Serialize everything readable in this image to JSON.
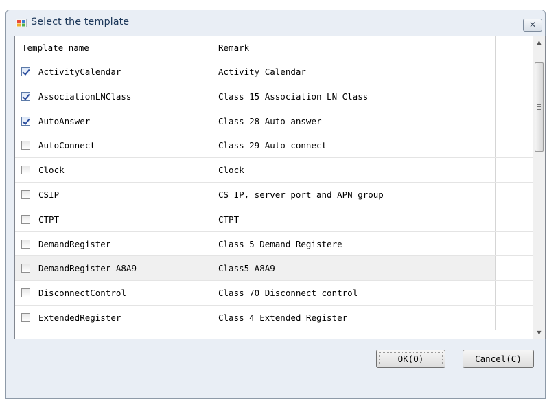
{
  "window": {
    "title": "Select the template",
    "close_glyph": "✕"
  },
  "grid": {
    "headers": [
      "Template name",
      "Remark"
    ],
    "rows": [
      {
        "name": "ActivityCalendar",
        "remark": "Activity Calendar",
        "checked": true
      },
      {
        "name": "AssociationLNClass",
        "remark": "Class 15 Association LN Class",
        "checked": true
      },
      {
        "name": "AutoAnswer",
        "remark": "Class 28 Auto answer",
        "checked": true
      },
      {
        "name": "AutoConnect",
        "remark": "Class 29 Auto connect",
        "checked": false
      },
      {
        "name": "Clock",
        "remark": "Clock",
        "checked": false
      },
      {
        "name": "CSIP",
        "remark": "CS IP, server port and APN group",
        "checked": false
      },
      {
        "name": "CTPT",
        "remark": "CTPT",
        "checked": false
      },
      {
        "name": "DemandRegister",
        "remark": "Class 5 Demand Registere",
        "checked": false
      },
      {
        "name": "DemandRegister_A8A9",
        "remark": "Class5 A8A9",
        "checked": false,
        "highlighted": true
      },
      {
        "name": "DisconnectControl",
        "remark": "Class 70  Disconnect control",
        "checked": false
      },
      {
        "name": "ExtendedRegister",
        "remark": "Class 4 Extended Register",
        "checked": false
      }
    ]
  },
  "buttons": {
    "ok": "OK(O)",
    "cancel": "Cancel(C)"
  },
  "icons": {
    "title": "template-window-icon",
    "scroll_up": "▲",
    "scroll_down": "▼"
  },
  "colors": {
    "title_text": "#1e395b",
    "window_bg": "#e9eef5",
    "check": "#2b4e9e"
  }
}
